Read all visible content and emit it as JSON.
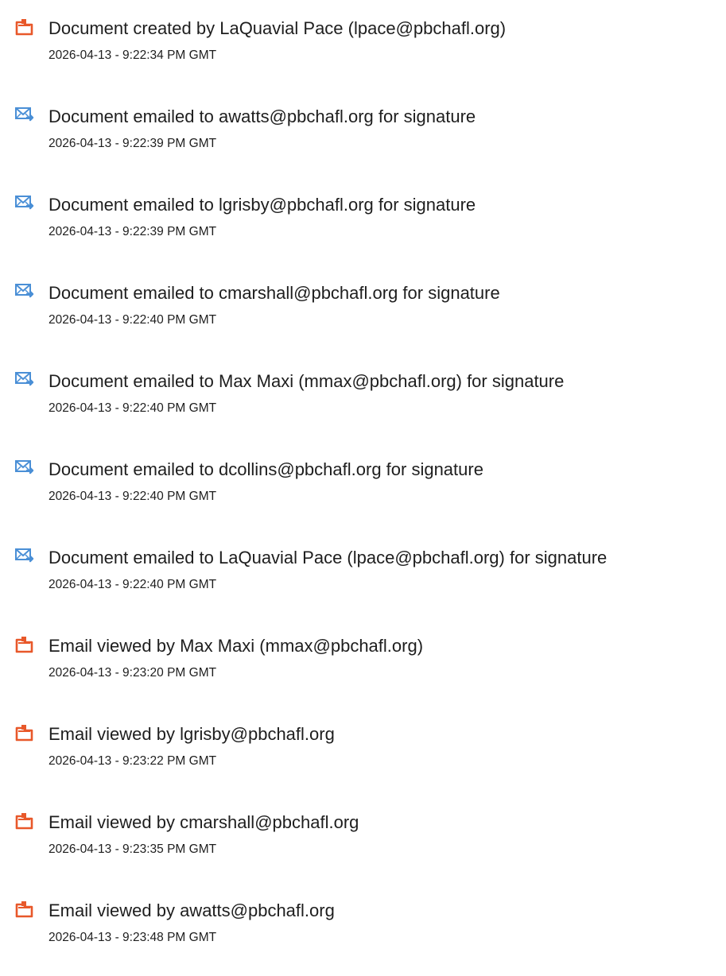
{
  "colors": {
    "doc_icon_accent": "#e8582a",
    "mail_icon_accent": "#4a8fd6",
    "text": "#1e1e1e"
  },
  "events": [
    {
      "icon": "document-icon",
      "title": "Document created by LaQuavial Pace (lpace@pbchafl.org)",
      "time": "2026-04-13 - 9:22:34 PM GMT"
    },
    {
      "icon": "email-sent-icon",
      "title": "Document emailed to awatts@pbchafl.org for signature",
      "time": "2026-04-13 - 9:22:39 PM GMT"
    },
    {
      "icon": "email-sent-icon",
      "title": "Document emailed to lgrisby@pbchafl.org for signature",
      "time": "2026-04-13 - 9:22:39 PM GMT"
    },
    {
      "icon": "email-sent-icon",
      "title": "Document emailed to cmarshall@pbchafl.org for signature",
      "time": "2026-04-13 - 9:22:40 PM GMT"
    },
    {
      "icon": "email-sent-icon",
      "title": "Document emailed to Max Maxi (mmax@pbchafl.org) for signature",
      "time": "2026-04-13 - 9:22:40 PM GMT"
    },
    {
      "icon": "email-sent-icon",
      "title": "Document emailed to dcollins@pbchafl.org for signature",
      "time": "2026-04-13 - 9:22:40 PM GMT"
    },
    {
      "icon": "email-sent-icon",
      "title": "Document emailed to LaQuavial Pace (lpace@pbchafl.org) for signature",
      "time": "2026-04-13 - 9:22:40 PM GMT"
    },
    {
      "icon": "document-icon",
      "title": "Email viewed by Max Maxi (mmax@pbchafl.org)",
      "time": "2026-04-13 - 9:23:20 PM GMT"
    },
    {
      "icon": "document-icon",
      "title": "Email viewed by lgrisby@pbchafl.org",
      "time": "2026-04-13 - 9:23:22 PM GMT"
    },
    {
      "icon": "document-icon",
      "title": "Email viewed by cmarshall@pbchafl.org",
      "time": "2026-04-13 - 9:23:35 PM GMT"
    },
    {
      "icon": "document-icon",
      "title": "Email viewed by awatts@pbchafl.org",
      "time": "2026-04-13 - 9:23:48 PM GMT"
    }
  ]
}
